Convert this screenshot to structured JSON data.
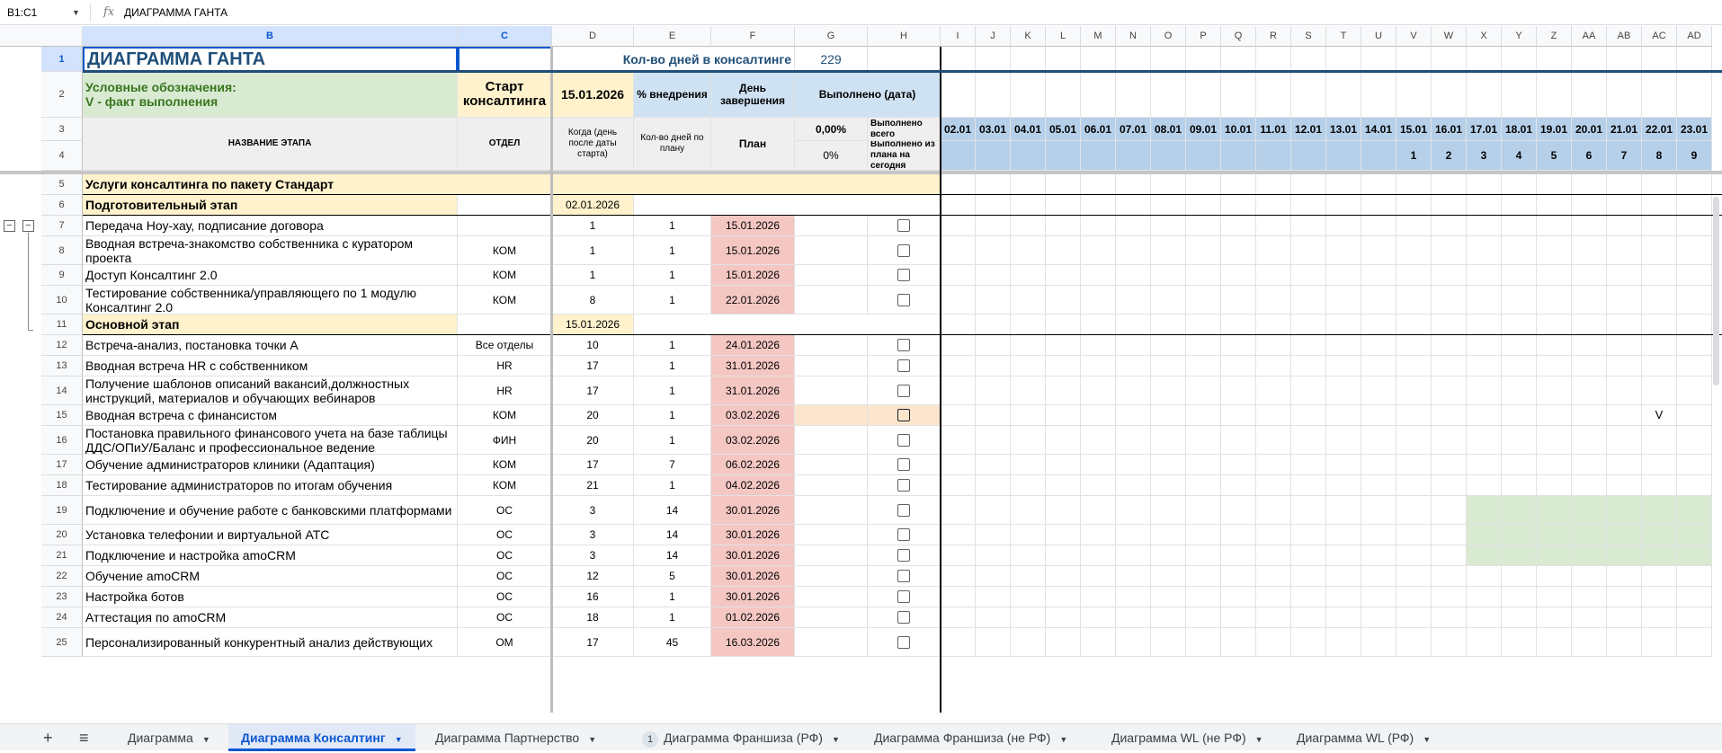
{
  "formula_bar": {
    "name_box": "B1:C1",
    "fx": "fx",
    "formula": "ДИАГРАММА ГАНТА"
  },
  "columns": [
    "B",
    "C",
    "D",
    "E",
    "F",
    "G",
    "H",
    "I",
    "J",
    "K",
    "L",
    "M",
    "N",
    "O",
    "P",
    "Q",
    "R",
    "S",
    "T",
    "U",
    "V",
    "W",
    "X",
    "Y",
    "Z",
    "AA",
    "AB",
    "AC",
    "AD"
  ],
  "header": {
    "title": "ДИАГРАММА ГАНТА",
    "days_label": "Кол-во дней в консалтинге",
    "days_value": "229",
    "legend_line1": "Условные обозначения:",
    "legend_line2": "V - факт выполнения",
    "start_label": "Старт консалтинга",
    "start_date": "15.01.2026",
    "pct_label": "% внедрения",
    "end_label": "День завершения",
    "done_label": "Выполнено (дата)",
    "stage_name": "НАЗВАНИЕ ЭТАПА",
    "dept": "ОТДЕЛ",
    "when": "Когда (день после даты старта)",
    "days_plan": "Кол-во дней по плану",
    "plan": "План",
    "done_total_pct": "0,00%",
    "done_total_label": "Выполнено всего",
    "done_today_pct": "0%",
    "done_today_label": "Выполнено из плана на сегодня"
  },
  "dates": [
    "02.01",
    "03.01",
    "04.01",
    "05.01",
    "06.01",
    "07.01",
    "08.01",
    "09.01",
    "10.01",
    "11.01",
    "12.01",
    "13.01",
    "14.01",
    "15.01",
    "16.01",
    "17.01",
    "18.01",
    "19.01",
    "20.01",
    "21.01",
    "22.01",
    "23.01"
  ],
  "day_nums": [
    "",
    "",
    "",
    "",
    "",
    "",
    "",
    "",
    "",
    "",
    "",
    "",
    "",
    "1",
    "2",
    "3",
    "4",
    "5",
    "6",
    "7",
    "8",
    "9"
  ],
  "rows": [
    {
      "num": "5",
      "type": "section",
      "name": "Услуги консалтинга по пакету Стандарт"
    },
    {
      "num": "6",
      "type": "stage",
      "name": "Подготовительный этап",
      "date": "02.01.2026"
    },
    {
      "num": "7",
      "name": "Передача Ноу-хау, подписание договора",
      "dept": "",
      "when": "1",
      "days": "1",
      "plan": "15.01.2026"
    },
    {
      "num": "8",
      "name": "Вводная встреча-знакомство собственника с куратором проекта",
      "dept": "КОМ",
      "when": "1",
      "days": "1",
      "plan": "15.01.2026"
    },
    {
      "num": "9",
      "name": "Доступ Консалтинг 2.0",
      "dept": "КОМ",
      "when": "1",
      "days": "1",
      "plan": "15.01.2026"
    },
    {
      "num": "10",
      "name": "Тестирование собственника/управляющего по 1 модулю Консалтинг 2.0",
      "dept": "КОМ",
      "when": "8",
      "days": "1",
      "plan": "22.01.2026"
    },
    {
      "num": "11",
      "type": "stage",
      "name": "Основной этап",
      "date": "15.01.2026"
    },
    {
      "num": "12",
      "name": "Встреча-анализ, постановка точки А",
      "dept": "Все отделы",
      "when": "10",
      "days": "1",
      "plan": "24.01.2026"
    },
    {
      "num": "13",
      "name": "Вводная встреча HR с собственником",
      "dept": "HR",
      "when": "17",
      "days": "1",
      "plan": "31.01.2026"
    },
    {
      "num": "14",
      "name": "Получение шаблонов описаний вакансий,должностных инструкций, материалов и обучающих вебинаров",
      "dept": "HR",
      "when": "17",
      "days": "1",
      "plan": "31.01.2026"
    },
    {
      "num": "15",
      "name": "Вводная встреча с финансистом",
      "dept": "КОМ",
      "when": "20",
      "days": "1",
      "plan": "03.02.2026",
      "mark": "V"
    },
    {
      "num": "16",
      "name": "Постановка правильного финансового учета на базе таблицы ДДС/ОПиУ/Баланс и профессиональное ведение",
      "dept": "ФИН",
      "when": "20",
      "days": "1",
      "plan": "03.02.2026"
    },
    {
      "num": "17",
      "name": "Обучение администраторов клиники (Адаптация)",
      "dept": "КОМ",
      "when": "17",
      "days": "7",
      "plan": "06.02.2026"
    },
    {
      "num": "18",
      "name": "Тестирование администраторов по итогам обучения",
      "dept": "КОМ",
      "when": "21",
      "days": "1",
      "plan": "04.02.2026"
    },
    {
      "num": "19",
      "name": "Подключение и обучение работе с банковскими платформами",
      "dept": "ОС",
      "when": "3",
      "days": "14",
      "plan": "30.01.2026"
    },
    {
      "num": "20",
      "name": "Установка телефонии и виртуальной АТС",
      "dept": "ОС",
      "when": "3",
      "days": "14",
      "plan": "30.01.2026"
    },
    {
      "num": "21",
      "name": "Подключение и настройка amoCRM",
      "dept": "ОС",
      "when": "3",
      "days": "14",
      "plan": "30.01.2026"
    },
    {
      "num": "22",
      "name": "Обучение amoCRM",
      "dept": "ОС",
      "when": "12",
      "days": "5",
      "plan": "30.01.2026"
    },
    {
      "num": "23",
      "name": "Настройка ботов",
      "dept": "ОС",
      "when": "16",
      "days": "1",
      "plan": "30.01.2026"
    },
    {
      "num": "24",
      "name": "Аттестация по amoCRM",
      "dept": "ОС",
      "when": "18",
      "days": "1",
      "plan": "01.02.2026"
    },
    {
      "num": "25",
      "name": "Персонализированный конкурентный анализ действующих",
      "dept": "ОМ",
      "when": "17",
      "days": "45",
      "plan": "16.03.2026"
    }
  ],
  "tabs": [
    {
      "label": "Диаграмма"
    },
    {
      "label": "Диаграмма Консалтинг",
      "active": true
    },
    {
      "label": "Диаграмма Партнерство"
    },
    {
      "label": "Диаграмма Франшиза (РФ)",
      "badge": "1"
    },
    {
      "label": "Диаграмма Франшиза (не РФ)"
    },
    {
      "label": "Диаграмма WL (не РФ)"
    },
    {
      "label": "Диаграмма WL (РФ)"
    }
  ],
  "colors": {
    "selection": "#0b57d0",
    "plan_cell": "#f4c7c3",
    "stage_cell": "#fff2cc",
    "legend_cell": "#d9ead3",
    "date_header": "#b6d0ea",
    "gantt_fill": "#d9ead3"
  }
}
